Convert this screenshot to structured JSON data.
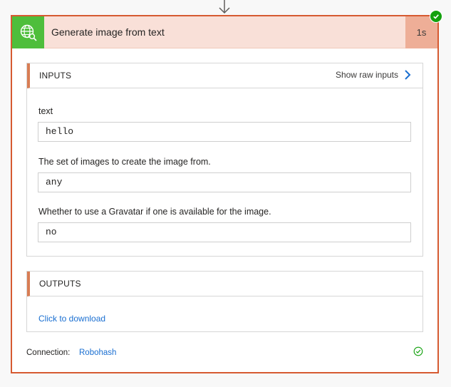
{
  "flow": {
    "connector_icon": "arrow-down-icon"
  },
  "action": {
    "title": "Generate image from text",
    "duration": "1s",
    "icon": "globe-search-icon",
    "status_icon": "check-icon",
    "status_color": "#13a10e",
    "accent_color": "#d65a31",
    "icon_color": "#4ebe3b"
  },
  "inputs": {
    "title": "INPUTS",
    "raw_link": "Show raw inputs",
    "fields": [
      {
        "label": "text",
        "value": "hello"
      },
      {
        "label": "The set of images to create the image from.",
        "value": "any"
      },
      {
        "label": "Whether to use a Gravatar if one is available for the image.",
        "value": "no"
      }
    ]
  },
  "outputs": {
    "title": "OUTPUTS",
    "download_link": "Click to download"
  },
  "connection": {
    "label": "Connection:",
    "value": "Robohash",
    "status_icon": "check-circle-icon"
  }
}
